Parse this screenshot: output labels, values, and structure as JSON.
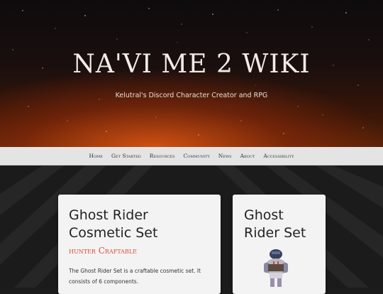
{
  "site": {
    "title": "NA'VI ME 2 WIKI",
    "tagline": "Kelutral's Discord Character Creator and RPG"
  },
  "nav": {
    "items": [
      "Home",
      "Get Started",
      "Resources",
      "Community",
      "News",
      "About",
      "Accessibility"
    ]
  },
  "main_card": {
    "title": "Ghost Rider Cosmetic Set",
    "badge": "hunter Craftable",
    "description": "The Ghost Rider Set is a craftable cosmetic set. It consists of 6 components."
  },
  "side_card": {
    "title": "Ghost Rider Set",
    "image_icon": "ghost-rider-armor-sprite"
  },
  "colors": {
    "nav_bg": "#e4e4e4",
    "badge": "#e04a3a",
    "card_bg": "#f3f3f3",
    "page_bg": "#1b1b1b"
  }
}
